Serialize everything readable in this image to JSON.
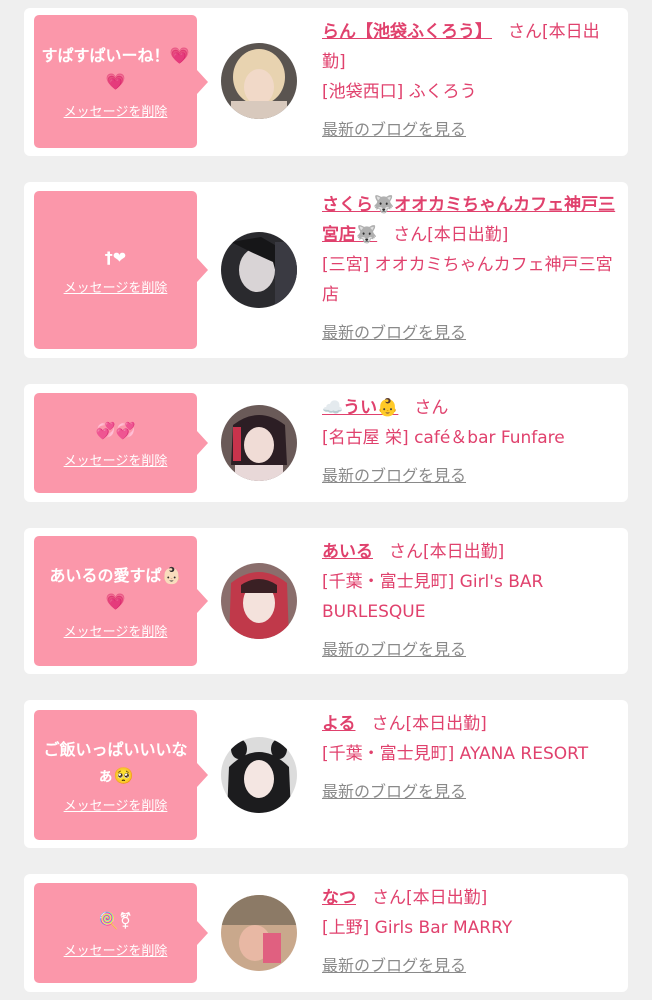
{
  "accent_color": "#e0416d",
  "bubble_color": "#fb97aa",
  "delete_label": "メッセージを削除",
  "blog_label": "最新のブログを見る",
  "cards": [
    {
      "message": "すぱすぱいーね！💗💗",
      "name": "らん【池袋ふくろう】",
      "suffix": "さん[本日出勤]",
      "shop": "[池袋西口] ふくろう",
      "avatar_icon": "user-avatar-photo"
    },
    {
      "message": "†❤",
      "name": "さくら🐺オオカミちゃんカフェ神戸三宮店🐺",
      "suffix": "さん[本日出勤]",
      "shop": "[三宮] オオカミちゃんカフェ神戸三宮店",
      "avatar_icon": "user-avatar-photo"
    },
    {
      "message": "💞💞",
      "name": "☁️うい👶",
      "suffix": "さん",
      "shop": "[名古屋 栄] café＆bar Funfare",
      "avatar_icon": "user-avatar-photo"
    },
    {
      "message": "あいるの愛すぱ👶🏻💗",
      "name": "あいる",
      "suffix": "さん[本日出勤]",
      "shop": "[千葉・富士見町] Girl's BAR BURLESQUE",
      "avatar_icon": "user-avatar-photo"
    },
    {
      "message": "ご飯いっぱいいいなぁ🥺",
      "name": "よる",
      "suffix": "さん[本日出勤]",
      "shop": "[千葉・富士見町] AYANA RESORT",
      "avatar_icon": "user-avatar-photo"
    },
    {
      "message": "🍭⚧",
      "name": "なつ",
      "suffix": "さん[本日出勤]",
      "shop": "[上野] Girls Bar MARRY",
      "avatar_icon": "user-avatar-photo"
    }
  ]
}
